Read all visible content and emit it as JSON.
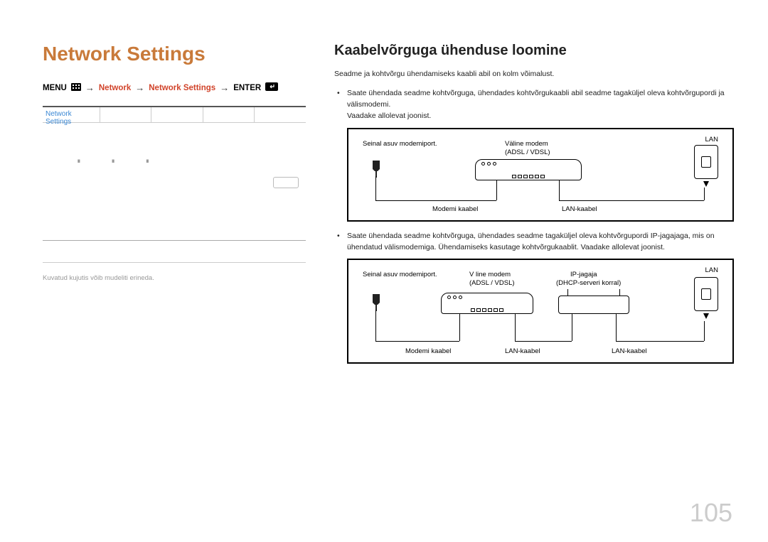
{
  "page_number": "105",
  "left": {
    "title": "Network Settings",
    "breadcrumb": {
      "menu": "MENU",
      "network": "Network",
      "network_settings": "Network Settings",
      "enter": "ENTER"
    },
    "panel_tab": "Network Settings",
    "footnote": "Kuvatud kujutis võib mudeliti erineda."
  },
  "right": {
    "title": "Kaabelvõrguga ühenduse loomine",
    "intro": "Seadme ja kohtvõrgu ühendamiseks kaabli abil on kolm võimalust.",
    "bullet1_line1": "Saate ühendada seadme kohtvõrguga, ühendades kohtvõrgukaabli abil seadme tagaküljel oleva kohtvõrgupordi ja välismodemi.",
    "bullet1_line2": "Vaadake allolevat joonist.",
    "bullet2": "Saate ühendada seadme kohtvõrguga, ühendades seadme tagaküljel oleva kohtvõrgupordi IP-jagajaga, mis on ühendatud välismodemiga. Ühendamiseks kasutage kohtvõrgukaablit. Vaadake allolevat joonist.",
    "diagram1": {
      "wall_port": "Seinal asuv modemiport.",
      "ext_modem": "Väline modem",
      "adsl": "(ADSL / VDSL)",
      "modem_cable": "Modemi kaabel",
      "lan_cable": "LAN-kaabel",
      "lan": "LAN"
    },
    "diagram2": {
      "wall_port": "Seinal asuv modemiport.",
      "vline_modem": "V line modem",
      "adsl": "(ADSL / VDSL)",
      "ip_sharer": "IP-jagaja",
      "dhcp": "(DHCP-serveri korral)",
      "modem_cable": "Modemi kaabel",
      "lan_cable1": "LAN-kaabel",
      "lan_cable2": "LAN-kaabel",
      "lan": "LAN"
    }
  }
}
